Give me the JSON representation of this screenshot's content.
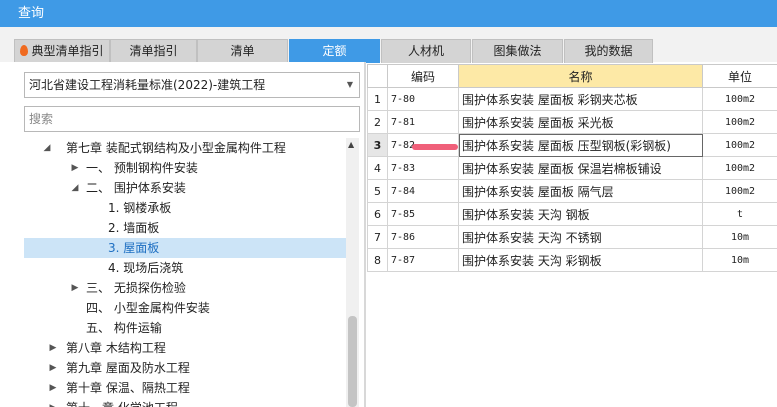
{
  "window": {
    "title": "查询"
  },
  "tabs": [
    {
      "label": "典型清单指引",
      "icon": "flame-icon"
    },
    {
      "label": "清单指引"
    },
    {
      "label": "清单"
    },
    {
      "label": "定额",
      "active": true
    },
    {
      "label": "人材机"
    },
    {
      "label": "图集做法"
    },
    {
      "label": "我的数据"
    }
  ],
  "left": {
    "standard_select": "河北省建设工程消耗量标准(2022)-建筑工程",
    "search_placeholder": "搜索",
    "tree": [
      {
        "arrow": "expanded",
        "label": "第七章 装配式钢结构及小型金属构件工程"
      },
      {
        "arrow": "collapsed",
        "label": "一、 预制钢构件安装"
      },
      {
        "arrow": "expanded",
        "label": "二、 围护体系安装"
      },
      {
        "label": "1. 钢楼承板"
      },
      {
        "label": "2. 墙面板"
      },
      {
        "label": "3. 屋面板",
        "selected": true
      },
      {
        "label": "4. 现场后浇筑"
      },
      {
        "arrow": "collapsed",
        "label": "三、 无损探伤检验"
      },
      {
        "label": "四、 小型金属构件安装"
      },
      {
        "label": "五、 构件运输"
      },
      {
        "arrow": "collapsed",
        "label": "第八章 木结构工程"
      },
      {
        "arrow": "collapsed",
        "label": "第九章 屋面及防水工程"
      },
      {
        "arrow": "collapsed",
        "label": "第十章 保温、隔热工程"
      },
      {
        "arrow": "collapsed",
        "label": "第十一章 化学池工程"
      }
    ]
  },
  "grid": {
    "columns": {
      "code": "编码",
      "name": "名称",
      "unit": "单位"
    },
    "current_row": 3,
    "rows": [
      {
        "no": "1",
        "code": "7-80",
        "name": "围护体系安装 屋面板 彩钢夹芯板",
        "unit": "100m2"
      },
      {
        "no": "2",
        "code": "7-81",
        "name": "围护体系安装 屋面板 采光板",
        "unit": "100m2"
      },
      {
        "no": "3",
        "code": "7-82",
        "name": "围护体系安装 屋面板 压型钢板(彩钢板)",
        "unit": "100m2"
      },
      {
        "no": "4",
        "code": "7-83",
        "name": "围护体系安装 屋面板 保温岩棉板铺设",
        "unit": "100m2"
      },
      {
        "no": "5",
        "code": "7-84",
        "name": "围护体系安装 屋面板 隔气层",
        "unit": "100m2"
      },
      {
        "no": "6",
        "code": "7-85",
        "name": "围护体系安装 天沟 钢板",
        "unit": "t"
      },
      {
        "no": "7",
        "code": "7-86",
        "name": "围护体系安装 天沟 不锈钢",
        "unit": "10m"
      },
      {
        "no": "8",
        "code": "7-87",
        "name": "围护体系安装 天沟 彩钢板",
        "unit": "10m"
      }
    ]
  },
  "colors": {
    "accent": "#3f9ae6",
    "header_highlight": "#fde9a6",
    "selected_row": "#cce4f7",
    "annotation": "#f0607a"
  }
}
